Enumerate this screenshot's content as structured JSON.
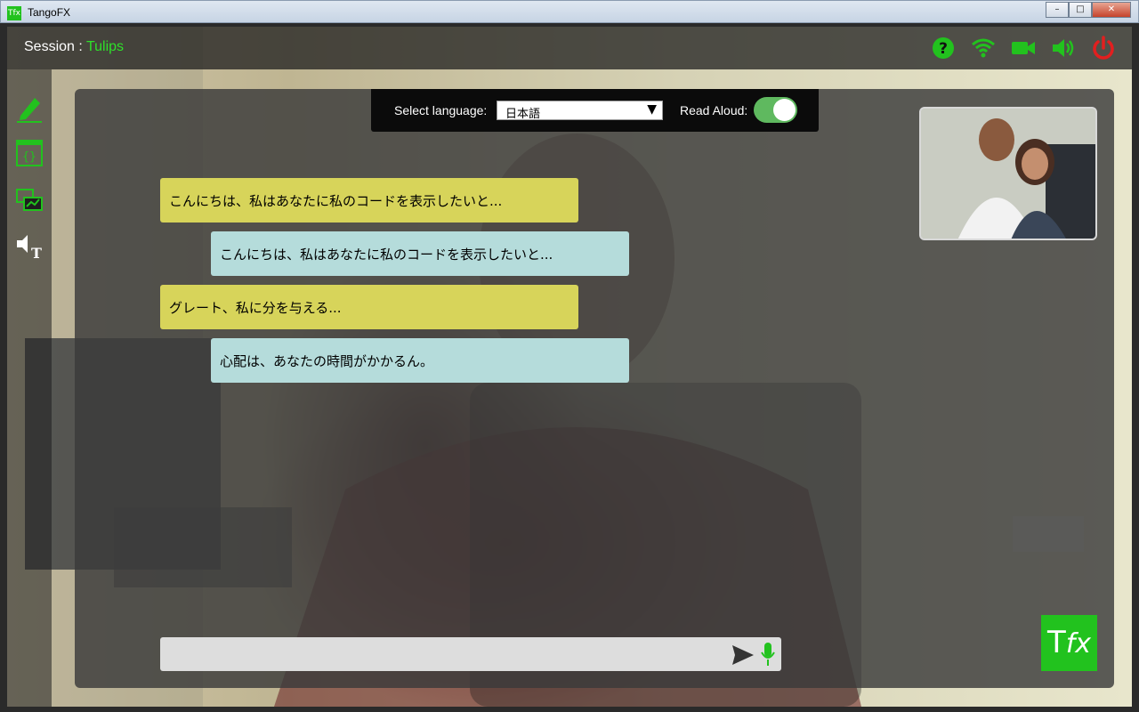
{
  "window": {
    "title": "TangoFX",
    "app_icon_text": "Tfx",
    "controls": [
      "–",
      "□",
      "✕"
    ]
  },
  "header": {
    "session_label": "Session : ",
    "session_name": "Tulips",
    "icons": [
      "help-icon",
      "wifi-icon",
      "camera-icon",
      "speaker-icon",
      "power-icon"
    ]
  },
  "toolbar_left": [
    "pencil-icon",
    "code-icon",
    "presentation-icon",
    "text-to-speech-icon"
  ],
  "language_bar": {
    "select_label": "Select language:",
    "selected_language": "日本語",
    "read_aloud_label": "Read Aloud:",
    "read_aloud_on": true
  },
  "messages": [
    {
      "side": "left",
      "text": "こんにちは、私はあなたに私のコードを表示したいと..."
    },
    {
      "side": "right",
      "text": "こんにちは、私はあなたに私のコードを表示したいと..."
    },
    {
      "side": "left",
      "text": "グレート、私に分を与える..."
    },
    {
      "side": "right",
      "text": "心配は、あなたの時間がかかるん。"
    }
  ],
  "input": {
    "value": ""
  },
  "brand": {
    "T": "T",
    "fx": "fx"
  },
  "colors": {
    "accent": "#22c21e",
    "left_bubble": "#d7d45a",
    "right_bubble": "#b5dcdb",
    "power": "#e21f1f"
  }
}
